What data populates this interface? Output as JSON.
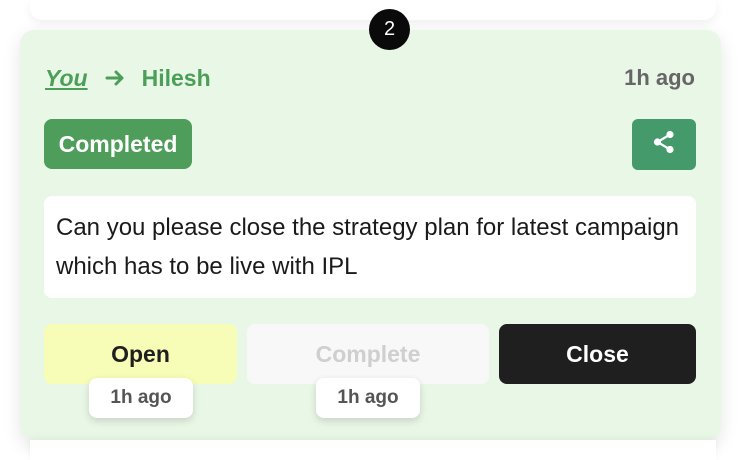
{
  "step": {
    "number": "2"
  },
  "header": {
    "from": "You",
    "to": "Hilesh",
    "time": "1h ago",
    "arrow_icon": "arrow-right-icon"
  },
  "status": {
    "label": "Completed"
  },
  "share": {
    "icon": "share-icon"
  },
  "message": {
    "text": "Can you please close the strategy plan for latest campaign which has to be live with IPL"
  },
  "actions": {
    "open_label": "Open",
    "complete_label": "Complete",
    "close_label": "Close",
    "open_time": "1h ago",
    "complete_time": "1h ago"
  },
  "colors": {
    "card_bg": "#e9f7e6",
    "accent_green": "#4c9f5a",
    "share_bg": "#459a6c",
    "open_bg": "#f7fcb6",
    "close_bg": "#1f1f1f"
  }
}
